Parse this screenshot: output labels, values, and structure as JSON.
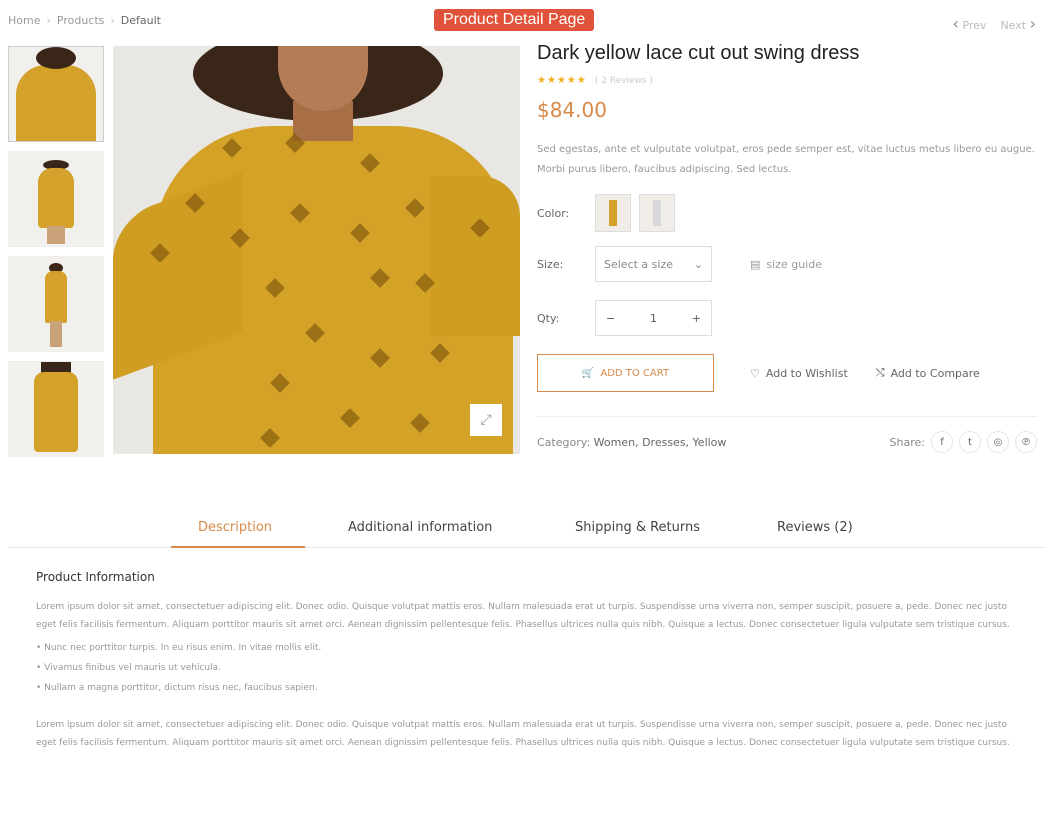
{
  "breadcrumb": [
    "Home",
    "Products",
    "Default"
  ],
  "page_badge": "Product Detail Page",
  "pager": {
    "prev": "Prev",
    "next": "Next"
  },
  "product": {
    "title": "Dark yellow lace cut out swing dress",
    "reviews": "( 2 Reviews )",
    "price": "$84.00",
    "description": "Sed egestas, ante et vulputate volutpat, eros pede semper est, vitae luctus metus libero eu augue. Morbi purus libero, faucibus adipiscing. Sed lectus.",
    "color_label": "Color:",
    "size_label": "Size:",
    "size_placeholder": "Select a size",
    "size_guide": "size guide",
    "qty_label": "Qty:",
    "qty_value": "1",
    "add_to_cart": "ADD TO CART",
    "wishlist": "Add to Wishlist",
    "compare": "Add to Compare",
    "category_label": "Category:",
    "categories": "Women, Dresses, Yellow",
    "share_label": "Share:",
    "rating": 5
  },
  "tabs": [
    "Description",
    "Additional information",
    "Shipping & Returns",
    "Reviews (2)"
  ],
  "content": {
    "heading": "Product Information",
    "paragraph1": "Lorem ipsum dolor sit amet, consectetuer adipiscing elit. Donec odio. Quisque volutpat mattis eros. Nullam malesuada erat ut turpis. Suspendisse urna viverra non, semper suscipit, posuere a, pede. Donec nec justo eget felis facilisis fermentum. Aliquam porttitor mauris sit amet orci. Aenean dignissim pellentesque felis. Phasellus ultrices nulla quis nibh. Quisque a lectus. Donec consectetuer ligula vulputate sem tristique cursus.",
    "bullets": [
      "• Nunc nec porttitor turpis. In eu risus enim. In vitae mollis elit.",
      "• Vivamus finibus vel mauris ut vehicula.",
      "• Nullam a magna porttitor, dictum risus nec, faucibus sapien."
    ],
    "paragraph2": "Lorem ipsum dolor sit amet, consectetuer adipiscing elit. Donec odio. Quisque volutpat mattis eros. Nullam malesuada erat ut turpis. Suspendisse urna viverra non, semper suscipit, posuere a, pede. Donec nec justo eget felis facilisis fermentum. Aliquam porttitor mauris sit amet orci. Aenean dignissim pellentesque felis. Phasellus ultrices nulla quis nibh. Quisque a lectus. Donec consectetuer ligula vulputate sem tristique cursus."
  },
  "icons": {
    "zoom": "expand-icon",
    "cart": "cart-icon",
    "wishlist": "heart-icon",
    "compare": "compare-icon",
    "size_guide": "ruler-icon",
    "social": [
      "facebook-icon",
      "twitter-icon",
      "instagram-icon",
      "pinterest-icon"
    ]
  },
  "colors": {
    "accent": "#d68a4a",
    "badge": "#e0533a",
    "star": "#f2b01e"
  }
}
